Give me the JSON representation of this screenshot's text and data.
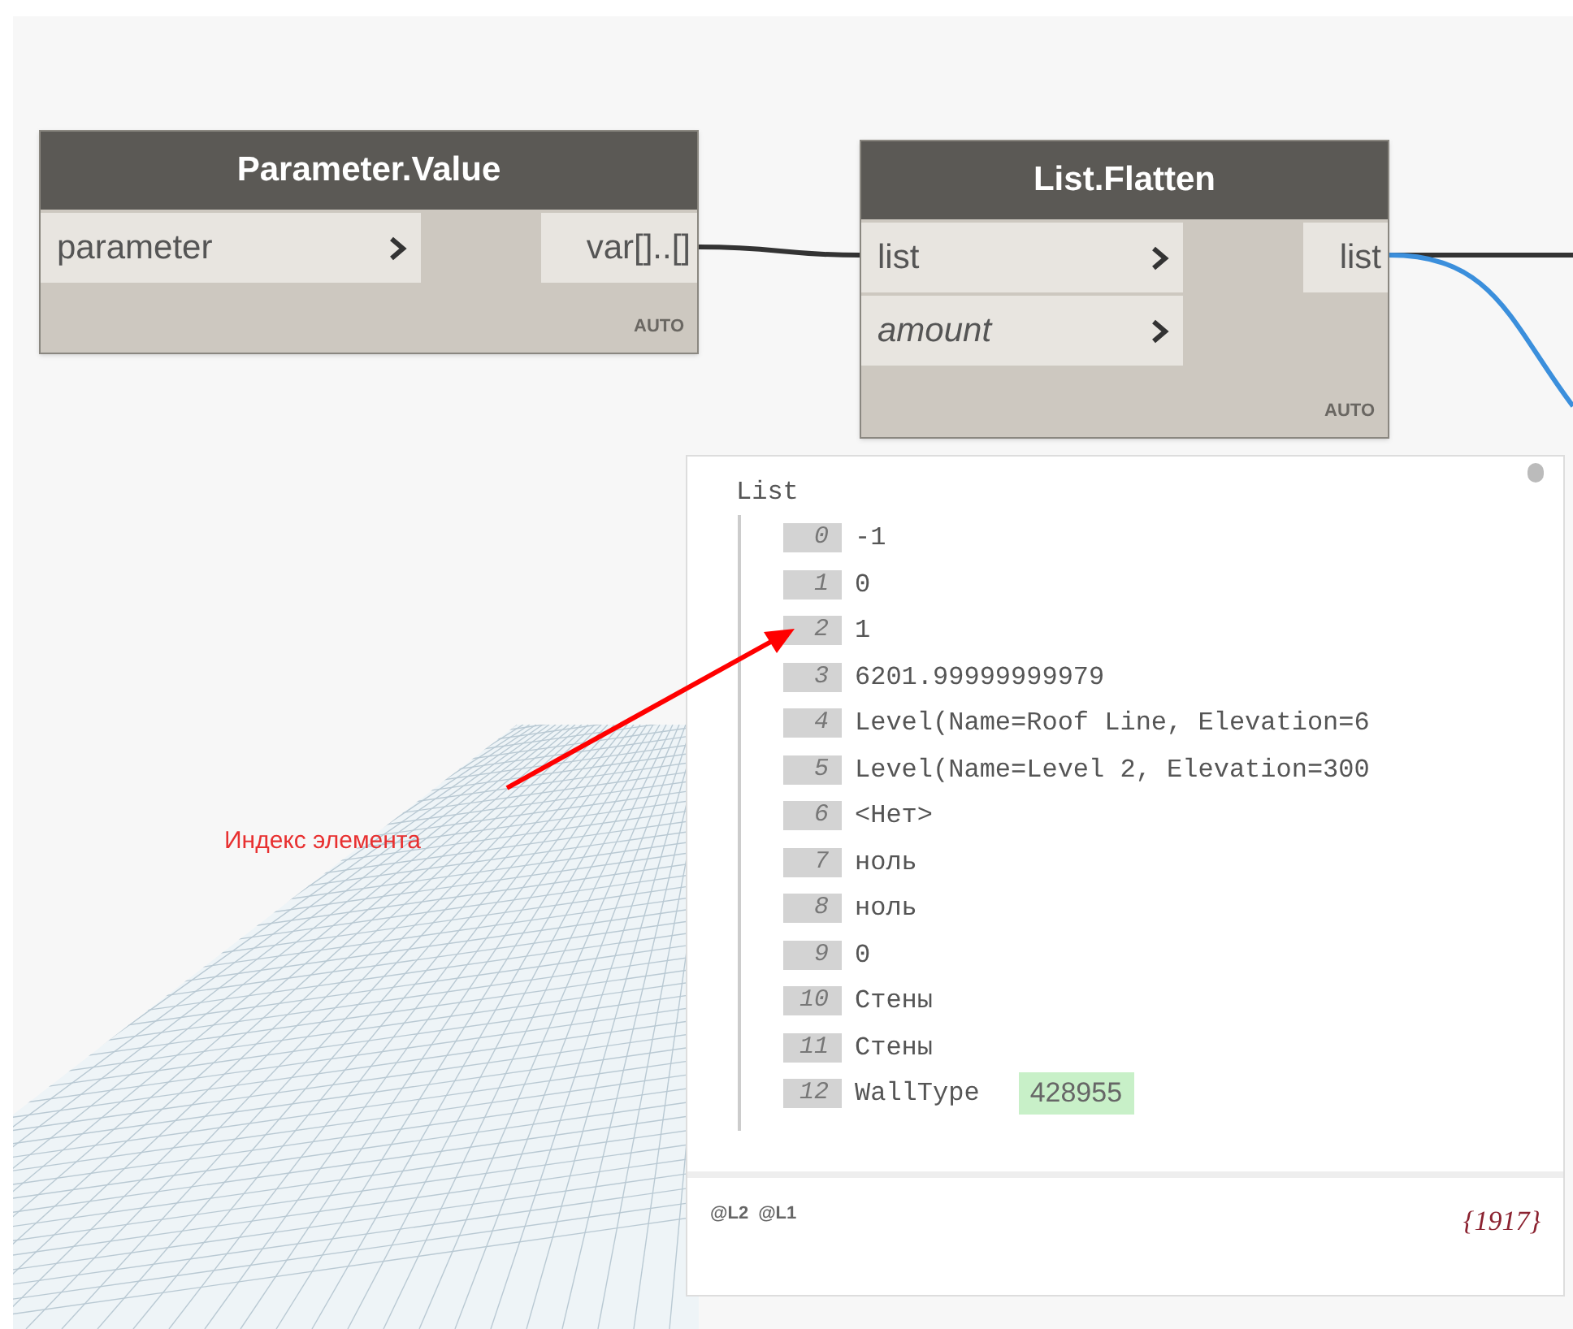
{
  "nodes": [
    {
      "title": "Parameter.Value",
      "inputs": [
        {
          "label": "parameter",
          "optional": false
        }
      ],
      "outputs": [
        "var[]..[]"
      ],
      "lacing": "AUTO"
    },
    {
      "title": "List.Flatten",
      "inputs": [
        {
          "label": "list",
          "optional": false
        },
        {
          "label": "amount",
          "optional": true
        }
      ],
      "outputs": [
        "list"
      ],
      "lacing": "AUTO"
    }
  ],
  "preview": {
    "header": "List",
    "items": [
      {
        "index": "0",
        "value": "-1"
      },
      {
        "index": "1",
        "value": "0"
      },
      {
        "index": "2",
        "value": "1"
      },
      {
        "index": "3",
        "value": "6201.99999999979"
      },
      {
        "index": "4",
        "value": "Level(Name=Roof Line, Elevation=6"
      },
      {
        "index": "5",
        "value": "Level(Name=Level 2, Elevation=300"
      },
      {
        "index": "6",
        "value": "<Нет>"
      },
      {
        "index": "7",
        "value": "ноль"
      },
      {
        "index": "8",
        "value": "ноль"
      },
      {
        "index": "9",
        "value": "0"
      },
      {
        "index": "10",
        "value": "Стены"
      },
      {
        "index": "11",
        "value": "Стены"
      },
      {
        "index": "12",
        "value": "WallType",
        "badge": "428955"
      }
    ],
    "levels": [
      "@L2",
      "@L1"
    ],
    "count": "{1917}"
  },
  "annotation": "Индекс элемента"
}
